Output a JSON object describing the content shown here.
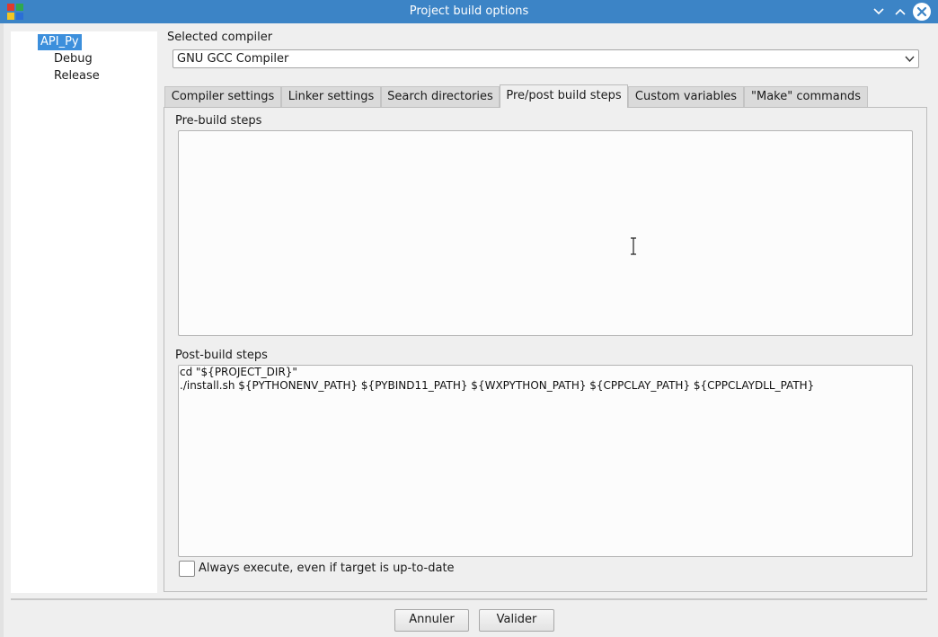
{
  "window": {
    "title": "Project build options"
  },
  "tree": {
    "items": [
      {
        "label": "API_Py",
        "selected": true
      },
      {
        "label": "Debug",
        "selected": false
      },
      {
        "label": "Release",
        "selected": false
      }
    ]
  },
  "compiler": {
    "label": "Selected compiler",
    "value": "GNU GCC Compiler"
  },
  "tabs": [
    {
      "label": "Compiler settings",
      "active": false
    },
    {
      "label": "Linker settings",
      "active": false
    },
    {
      "label": "Search directories",
      "active": false
    },
    {
      "label": "Pre/post build steps",
      "active": true
    },
    {
      "label": "Custom variables",
      "active": false
    },
    {
      "label": "\"Make\" commands",
      "active": false
    }
  ],
  "prebuild": {
    "label": "Pre-build steps",
    "value": ""
  },
  "postbuild": {
    "label": "Post-build steps",
    "value": "cd \"${PROJECT_DIR}\"\n./install.sh ${PYTHONENV_PATH} ${PYBIND11_PATH} ${WXPYTHON_PATH} ${CPPCLAY_PATH} ${CPPCLAYDLL_PATH}"
  },
  "always_execute": {
    "label": "Always execute, even if target is up-to-date",
    "checked": false
  },
  "buttons": {
    "cancel": "Annuler",
    "ok": "Valider"
  },
  "icons": {
    "app": "codeblocks-app-icon",
    "minimize": "chevron-down-icon",
    "maximize": "chevron-up-icon",
    "close": "close-icon",
    "combo": "chevron-down-icon",
    "cursor": "text-cursor-icon"
  },
  "colors": {
    "titlebar": "#3c84c6",
    "selection": "#3c8fdc"
  }
}
